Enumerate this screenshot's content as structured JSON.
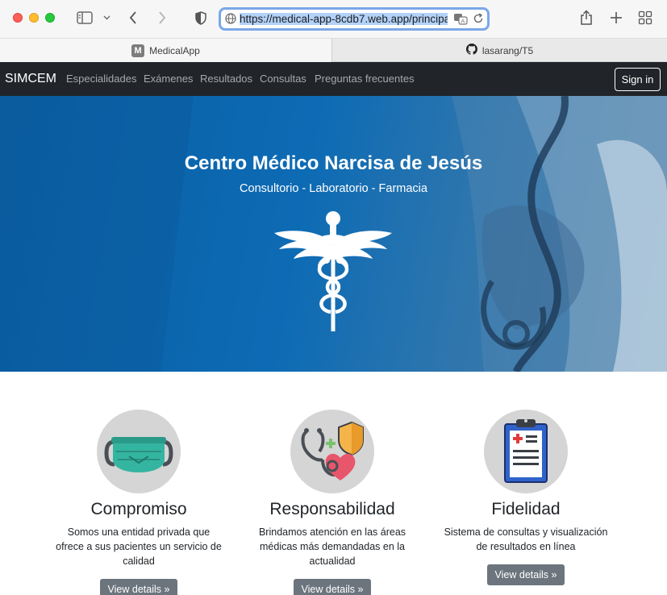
{
  "browser": {
    "url": "https://medical-app-8cdb7.web.app/principal",
    "tabs": [
      {
        "title": "MedicalApp",
        "favicon": "M"
      },
      {
        "title": "lasarang/T5",
        "favicon": "github-icon"
      }
    ]
  },
  "navbar": {
    "brand": "SIMCEM",
    "links": [
      "Especialidades",
      "Exámenes",
      "Resultados",
      "Consultas",
      "Preguntas frecuentes"
    ],
    "signin": "Sign in"
  },
  "hero": {
    "title": "Centro Médico Narcisa de Jesús",
    "subtitle": "Consultorio - Laboratorio - Farmacia",
    "background_color": "#0d6bb4"
  },
  "features": [
    {
      "title": "Compromiso",
      "text": "Somos una entidad privada que ofrece a sus pacientes un servicio de calidad",
      "button": "View details »",
      "icon": "face-mask-icon"
    },
    {
      "title": "Responsabilidad",
      "text": "Brindamos atención en las áreas médicas más demandadas en la actualidad",
      "button": "View details »",
      "icon": "stethoscope-heart-icon"
    },
    {
      "title": "Fidelidad",
      "text": "Sistema de consultas y visualización de resultados en línea",
      "button": "View details »",
      "icon": "clipboard-icon"
    }
  ]
}
